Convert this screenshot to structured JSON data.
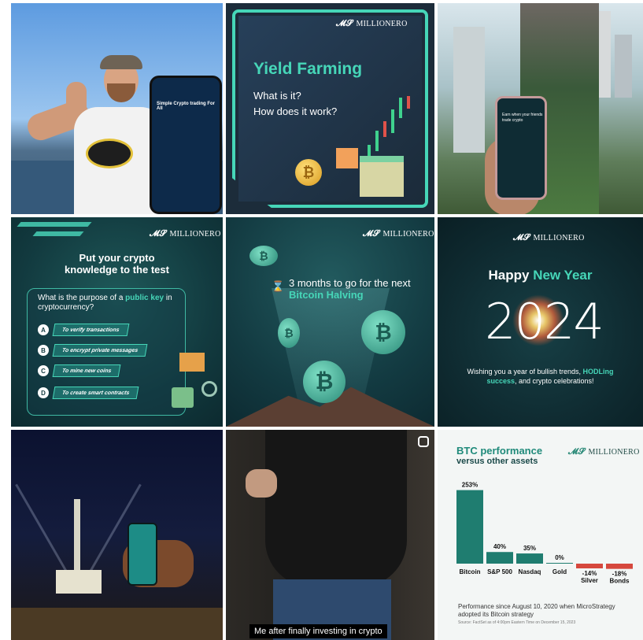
{
  "brand": {
    "name": "MILLIONERO",
    "logo_glyph": "𝓜𝓢"
  },
  "tile1": {
    "phone_text": "Simple Crypto trading For All"
  },
  "tile2": {
    "title_accent": "Yield",
    "title_rest": " Farming",
    "line1": "What is it?",
    "line2": "How does it work?"
  },
  "tile3": {
    "phone_text": "Earn when your friends trade crypto"
  },
  "tile4": {
    "title_line1": "Put your crypto",
    "title_line2": "knowledge to the test",
    "question_pre": "What is the purpose of a ",
    "question_key": "public key",
    "question_post": " in cryptocurrency?",
    "options": [
      {
        "letter": "A",
        "text": "To verify transactions"
      },
      {
        "letter": "B",
        "text": "To encrypt private messages"
      },
      {
        "letter": "C",
        "text": "To mine new coins"
      },
      {
        "letter": "D",
        "text": "To create smart contracts"
      }
    ]
  },
  "tile5": {
    "text_pre": "3 months to go for the next ",
    "text_accent": "Bitcoin Halving"
  },
  "tile6": {
    "happy": "Happy ",
    "new_year": "New Year",
    "year": "2024",
    "wish_pre": "Wishing you a year of bullish trends, ",
    "wish_accent": "HODLing success",
    "wish_post": ", and crypto celebrations!"
  },
  "tile8": {
    "caption": "Me after finally investing in crypto"
  },
  "tile9": {
    "title": "BTC performance",
    "subtitle": "versus other assets",
    "footnote": "Performance since August 10, 2020 when MicroStrategy adopted its Bitcoin strategy",
    "source": "Source: FactSet as of 4:00pm Eastern Time on December 15, 2023",
    "positive_color": "#1f7d70",
    "negative_color": "#d6483d"
  },
  "chart_data": {
    "type": "bar",
    "title": "BTC performance versus other assets",
    "categories": [
      "Bitcoin",
      "S&P 500",
      "Nasdaq",
      "Gold",
      "Silver",
      "Bonds"
    ],
    "values": [
      253,
      40,
      35,
      0,
      -14,
      -18
    ],
    "value_labels": [
      "253%",
      "40%",
      "35%",
      "0%",
      "-14%",
      "-18%"
    ],
    "ylim": [
      -20,
      260
    ]
  }
}
